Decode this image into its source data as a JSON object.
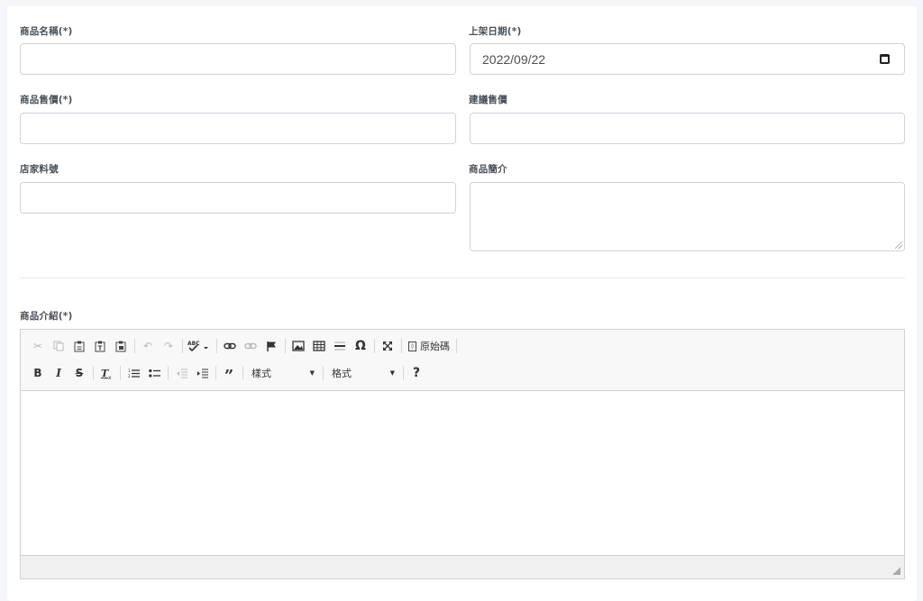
{
  "form": {
    "product_name_label": "商品名稱(*)",
    "launch_date_label": "上架日期(*)",
    "launch_date_value": "2022/09/22",
    "price_label": "商品售價(*)",
    "suggested_price_label": "建議售價",
    "store_sku_label": "店家料號",
    "summary_label": "商品簡介",
    "description_label": "商品介紹(*)"
  },
  "editor": {
    "source_label": "原始碼",
    "styles_combo": "樣式",
    "format_combo": "格式",
    "help_glyph": "?"
  }
}
